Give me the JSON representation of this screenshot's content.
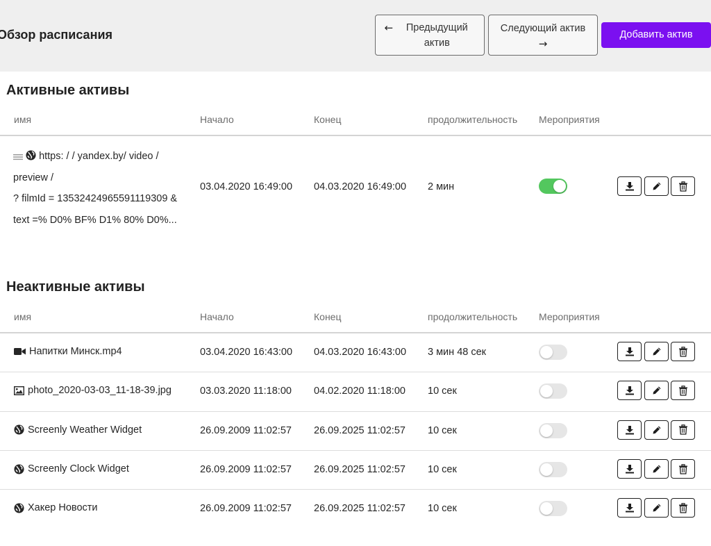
{
  "header": {
    "title": "Обзор расписания",
    "prev_label": "Предыдущий актив",
    "next_label": "Следующий актив",
    "add_label": "Добавить актив"
  },
  "columns": {
    "name": "имя",
    "start": "Начало",
    "end": "Конец",
    "duration": "продолжительность",
    "events": "Мероприятия"
  },
  "active": {
    "title": "Активные активы",
    "rows": [
      {
        "icon": "globe-icon",
        "name_lines": [
          "https: / / yandex.by/ video /",
          "preview /",
          "? filmId = 13532424965591119309 &",
          "text =% D0% BF% D1% 80% D0%..."
        ],
        "start": "03.04.2020 16:49:00",
        "end": "04.03.2020 16:49:00",
        "duration": "2 мин",
        "enabled": true
      }
    ]
  },
  "inactive": {
    "title": "Неактивные активы",
    "rows": [
      {
        "icon": "video-icon",
        "name": "Напитки Минск.mp4",
        "start": "03.04.2020 16:43:00",
        "end": "04.03.2020 16:43:00",
        "duration": "3 мин 48 сек",
        "enabled": false
      },
      {
        "icon": "image-icon",
        "name": "photo_2020-03-03_11-18-39.jpg",
        "start": "03.03.2020 11:18:00",
        "end": "04.02.2020 11:18:00",
        "duration": "10 сек",
        "enabled": false
      },
      {
        "icon": "globe-icon",
        "name": "Screenly Weather Widget",
        "start": "26.09.2009 11:02:57",
        "end": "26.09.2025 11:02:57",
        "duration": "10 сек",
        "enabled": false
      },
      {
        "icon": "globe-icon",
        "name": "Screenly Clock Widget",
        "start": "26.09.2009 11:02:57",
        "end": "26.09.2025 11:02:57",
        "duration": "10 сек",
        "enabled": false
      },
      {
        "icon": "globe-icon",
        "name": "Хакер Новости",
        "start": "26.09.2009 11:02:57",
        "end": "26.09.2025 11:02:57",
        "duration": "10 сек",
        "enabled": false
      }
    ]
  },
  "colors": {
    "accent": "#7b10f0",
    "toggle_on": "#53c75e",
    "toggle_off": "#e6e6e6",
    "header_bg": "#efefef"
  }
}
